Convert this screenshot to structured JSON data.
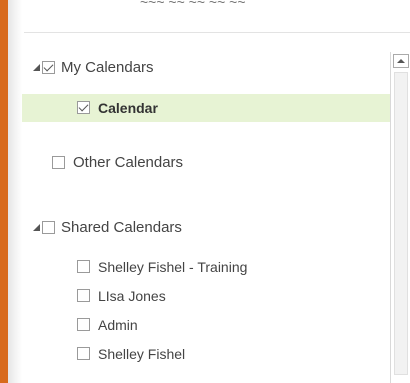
{
  "top_partial_text": "~~~ ~~ ~~ ~~ ~~",
  "groups": {
    "my_calendars": {
      "label": "My Calendars",
      "checked": true,
      "expanded": true
    },
    "calendar": {
      "label": "Calendar",
      "checked": true,
      "selected": true
    },
    "other_calendars": {
      "label": "Other Calendars",
      "checked": false
    },
    "shared_calendars": {
      "label": "Shared Calendars",
      "checked": false,
      "expanded": true
    },
    "shared_items": [
      {
        "label": "Shelley Fishel - Training",
        "checked": false
      },
      {
        "label": "LIsa Jones",
        "checked": false
      },
      {
        "label": "Admin",
        "checked": false
      },
      {
        "label": "Shelley Fishel",
        "checked": false
      }
    ]
  },
  "colors": {
    "accent": "#d86a1c",
    "selected_row": "#e7f3d4"
  },
  "icons": {
    "expand": "collapse-triangle-icon",
    "checkbox_checked": "checkmark-icon",
    "scroll_up": "scroll-up-arrow-icon"
  }
}
